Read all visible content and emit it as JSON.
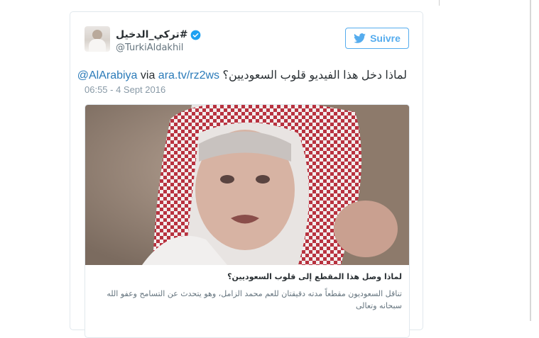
{
  "user": {
    "display_name": "تركي_الدخيل#",
    "handle": "@TurkiAldakhil",
    "verified_icon": "verified-badge-icon"
  },
  "follow_button": {
    "label": "Suivre",
    "icon": "twitter-bird-icon",
    "color": "#55acee"
  },
  "tweet": {
    "text_arabic": "لماذا دخل هذا الفيديو قلوب السعوديين؟",
    "link": "ara.tv/rz2ws",
    "via": "via",
    "mention": "@AlArabiya",
    "timestamp": "06:55 - 4 Sept 2016"
  },
  "card": {
    "title": "لماذا وصل هذا المقطع إلى قلوب السعوديين؟",
    "description": "تناقل السعوديون مقطعاً مدته دقيقتان للعم محمد الزامل، وهو يتحدث عن التسامح وعفو الله سبحانه وتعالى"
  },
  "colors": {
    "link": "#2b7bb9",
    "text": "#292f33",
    "muted": "#8899a6",
    "border": "#e1e8ed"
  }
}
